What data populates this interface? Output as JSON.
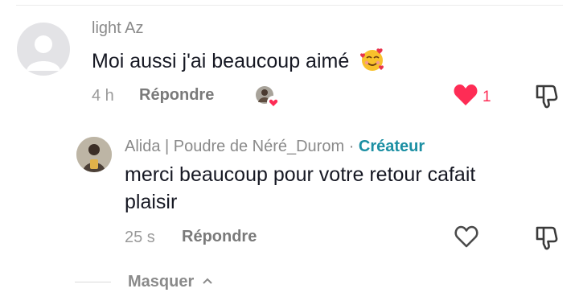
{
  "comments": [
    {
      "username": "light Az",
      "text": "Moi aussi j'ai beaucoup aimé",
      "emoji": "smiling-face-with-hearts",
      "time": "4 h",
      "reply_label": "Répondre",
      "liked": true,
      "like_count": "1"
    },
    {
      "username": "Alida | Poudre de Néré_Durom",
      "separator": "·",
      "badge": "Créateur",
      "text_line1": "merci beaucoup pour votre retour cafait",
      "text_line2": "plaisir",
      "time": "25 s",
      "reply_label": "Répondre",
      "liked": false
    }
  ],
  "collapse_label": "Masquer",
  "colors": {
    "like": "#fe2c55",
    "creator": "#1b8fa3",
    "text": "#161823",
    "muted": "#8a8a8a"
  }
}
